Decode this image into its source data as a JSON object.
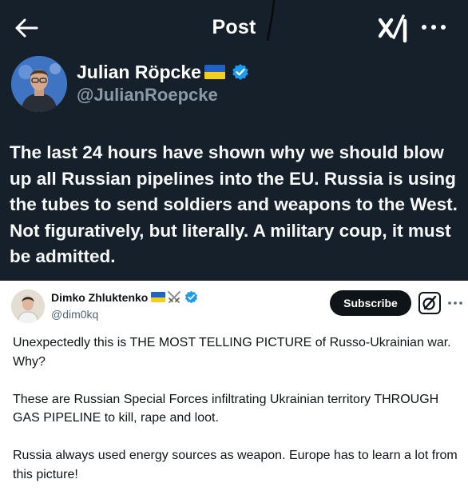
{
  "header": {
    "title": "Post"
  },
  "post": {
    "author_name": "Julian Röpcke",
    "author_handle": "@JulianRoepcke",
    "text": "The last 24 hours have shown why we should blow up all Russian pipelines into the EU. Russia is using the tubes to send soldiers and weapons to the West. Not figuratively, but literally. A military coup, it must be admitted."
  },
  "quoted_post": {
    "author_name": "Dimko Zhluktenko",
    "author_handle": "@dim0kq",
    "subscribe_label": "Subscribe",
    "paragraphs": [
      "Unexpectedly this is THE MOST TELLING PICTURE of Russo-Ukrainian war. Why?",
      "These are Russian Special Forces infiltrating Ukrainian territory THROUGH GAS PIPELINE to kill, rape and loot.",
      "Russia always used energy sources as weapon. Europe has to learn a lot from this picture!"
    ]
  },
  "icons": {
    "back": "arrow-left-icon",
    "xai": "xai-logo-icon",
    "more": "more-horizontal-icon",
    "verified": "verified-badge-icon",
    "grok": "grok-icon",
    "flag": "ukraine-flag-icon",
    "swords": "crossed-swords-icon"
  },
  "colors": {
    "dark_background": "#15202b",
    "secondary_text_dark": "#8b98a5",
    "verified_blue": "#1d9bf0",
    "button_black": "#0f1419",
    "secondary_text_light": "#536471"
  }
}
